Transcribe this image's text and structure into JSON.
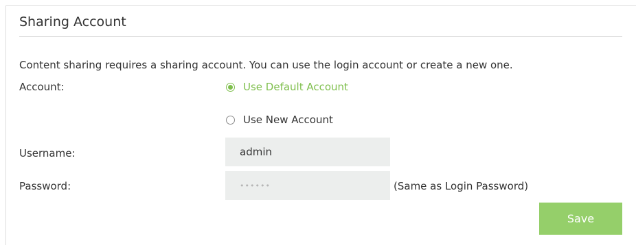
{
  "section": {
    "title": "Sharing Account",
    "description": "Content sharing requires a sharing account. You can use the login account or create a new one."
  },
  "account": {
    "label": "Account:",
    "options": [
      {
        "label": "Use Default Account",
        "selected": true
      },
      {
        "label": "Use New Account",
        "selected": false
      }
    ]
  },
  "username": {
    "label": "Username:",
    "value": "admin"
  },
  "password": {
    "label": "Password:",
    "value": "••••••",
    "hint": "(Same as Login Password)"
  },
  "actions": {
    "save_label": "Save"
  },
  "colors": {
    "accent": "#7fbf4d",
    "button": "#95cf6a",
    "input_bg": "#eceeed"
  }
}
